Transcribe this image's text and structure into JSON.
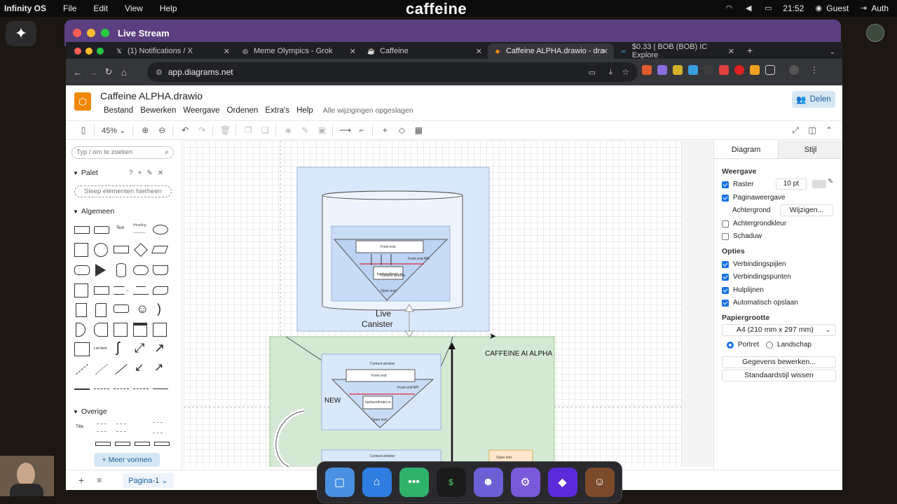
{
  "os": {
    "name": "Infinity OS",
    "menus": [
      "File",
      "Edit",
      "View",
      "Help"
    ],
    "center_title": "caffeine",
    "time": "21:52",
    "user": "Guest",
    "auth": "Auth"
  },
  "live_stream": {
    "title": "Live Stream"
  },
  "browser": {
    "tabs": [
      {
        "title": "(1) Notifications / X",
        "icon": "x-logo-icon",
        "active": false
      },
      {
        "title": "Meme Olympics - Grok",
        "icon": "grok-icon",
        "active": false
      },
      {
        "title": "Caffeine",
        "icon": "caffeine-icon",
        "active": false
      },
      {
        "title": "Caffeine ALPHA.drawio - dra",
        "icon": "drawio-icon",
        "active": true
      },
      {
        "title": "$0.33 | BOB (BOB) IC Explore",
        "icon": "ic-icon",
        "active": false
      }
    ],
    "url": "app.diagrams.net"
  },
  "drawio": {
    "title": "Caffeine ALPHA.drawio",
    "menus": [
      "Bestand",
      "Bewerken",
      "Weergave",
      "Ordenen",
      "Extra's",
      "Help"
    ],
    "saved_status": "Alle wijzigingen opgeslagen",
    "share_label": "Delen",
    "zoom": "45%",
    "search_placeholder": "Typ / om te zoeken",
    "palette_label": "Palet",
    "drop_zone": "Sleep elementen hierheen",
    "general_label": "Algemeen",
    "other_label": "Overige",
    "more_shapes": "+ Meer vormen",
    "page_tab": "Pagina-1"
  },
  "canvas": {
    "live_canister": {
      "line1": "Live",
      "line2": "Canister"
    },
    "caffeine_label": "CAFFEINE AI ALPHA",
    "new_label": "NEW",
    "context_window": "Context window",
    "front_end": "Front end",
    "front_end_api": "Front end API",
    "backend": "backend/main.m",
    "open_end": "Open end"
  },
  "format_panel": {
    "tabs": [
      "Diagram",
      "Stijl"
    ],
    "view_section": "Weergave",
    "raster": "Raster",
    "raster_size": "10 pt",
    "page_view": "Paginaweergave",
    "background": "Achtergrond",
    "change_btn": "Wijzigen...",
    "bg_color": "Achtergrondkleur",
    "shadow": "Schaduw",
    "options_section": "Opties",
    "opt1": "Verbindingspijlen",
    "opt2": "Verbindingspunten",
    "opt3": "Hulplijnen",
    "opt4": "Automatisch opslaan",
    "paper_section": "Papiergrootte",
    "paper_size": "A4 (210 mm x 297 mm)",
    "portrait": "Portret",
    "landscape": "Landschap",
    "edit_data_btn": "Gegevens bewerken...",
    "default_style_btn": "Standaardstijl wissen"
  },
  "colors": {
    "accent": "#1a73e8",
    "drawio_orange": "#f08705",
    "live_bar": "#5b3f80"
  }
}
